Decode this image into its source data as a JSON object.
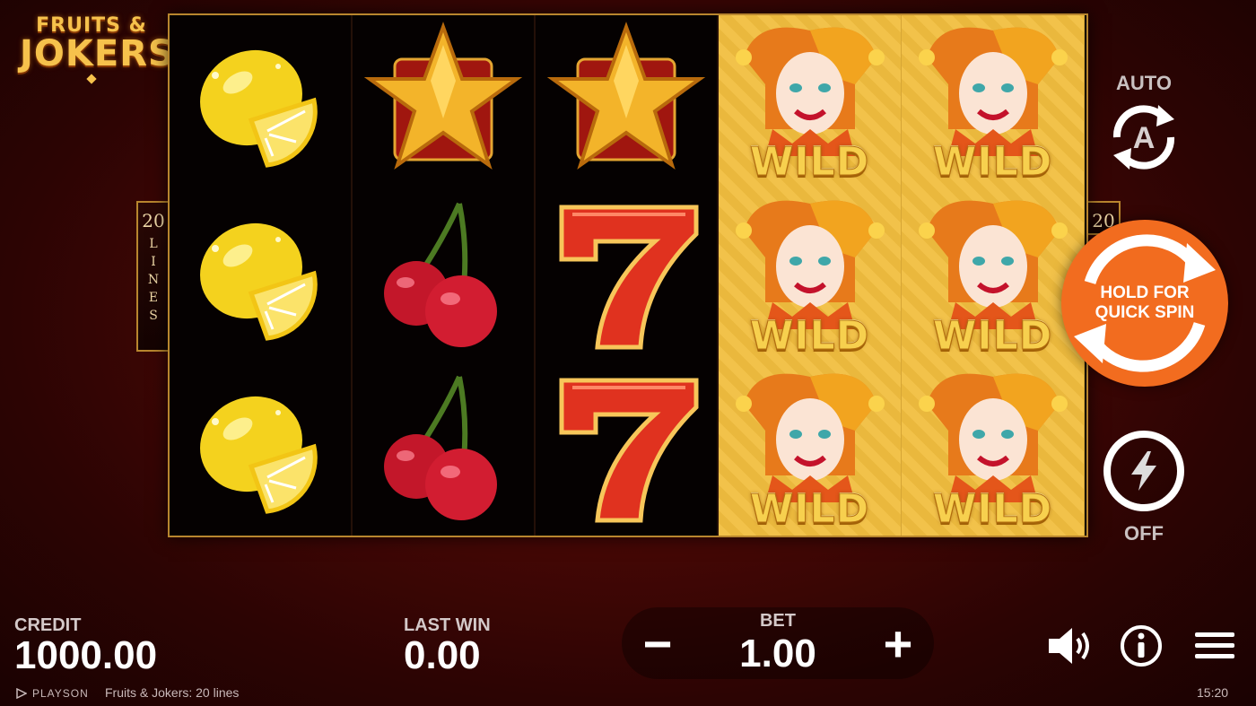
{
  "logo": {
    "line1": "FRUITS &",
    "line2": "JOKERS"
  },
  "paylines": {
    "count": "20",
    "word": "LINES"
  },
  "reels": [
    [
      "lemon",
      "lemon",
      "lemon"
    ],
    [
      "star",
      "cherry",
      "cherry"
    ],
    [
      "star",
      "seven",
      "seven"
    ],
    [
      "wild",
      "wild",
      "wild"
    ],
    [
      "wild",
      "wild",
      "wild"
    ]
  ],
  "wild_label": "WILD",
  "controls": {
    "auto_label": "AUTO",
    "auto_icon_letter": "A",
    "spin_label_line1": "HOLD FOR",
    "spin_label_line2": "QUICK SPIN",
    "turbo_state": "OFF"
  },
  "credit": {
    "label": "CREDIT",
    "value": "1000.00"
  },
  "last_win": {
    "label": "LAST WIN",
    "value": "0.00"
  },
  "bet": {
    "label": "BET",
    "value": "1.00",
    "minus": "−",
    "plus": "+"
  },
  "footer": {
    "brand": "PLAYSON",
    "game_title": "Fruits & Jokers: 20 lines",
    "clock": "15:20"
  },
  "colors": {
    "accent_orange": "#f26c1f",
    "frame_gold": "#b8862e",
    "wild_gold": "#f2c24a"
  }
}
